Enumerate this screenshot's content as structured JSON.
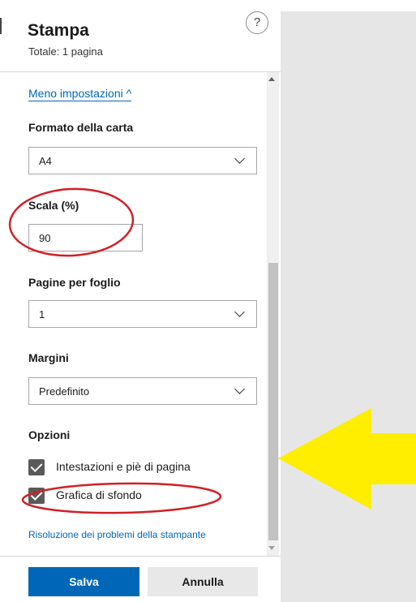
{
  "header": {
    "title": "Stampa",
    "subtitle": "Totale: 1 pagina",
    "help": "?"
  },
  "settings": {
    "toggle_link": "Meno impostazioni ^",
    "paper_size": {
      "label": "Formato della carta",
      "value": "A4"
    },
    "scale": {
      "label": "Scala (%)",
      "value": "90"
    },
    "pages_per_sheet": {
      "label": "Pagine per foglio",
      "value": "1"
    },
    "margins": {
      "label": "Margini",
      "value": "Predefinito"
    },
    "options": {
      "label": "Opzioni",
      "items": [
        {
          "label": "Intestazioni e piè di pagina",
          "checked": true
        },
        {
          "label": "Grafica di sfondo",
          "checked": true
        }
      ]
    },
    "troubleshoot_link": "Risoluzione dei problemi della stampante"
  },
  "footer": {
    "save_label": "Salva",
    "cancel_label": "Annulla"
  },
  "colors": {
    "accent": "#0067b8",
    "annotation_red": "#d21f26",
    "annotation_arrow": "#ffee00",
    "preview_background": "#e6e6e6"
  },
  "annotations": {
    "arrow_icon": "arrow-left-icon"
  }
}
